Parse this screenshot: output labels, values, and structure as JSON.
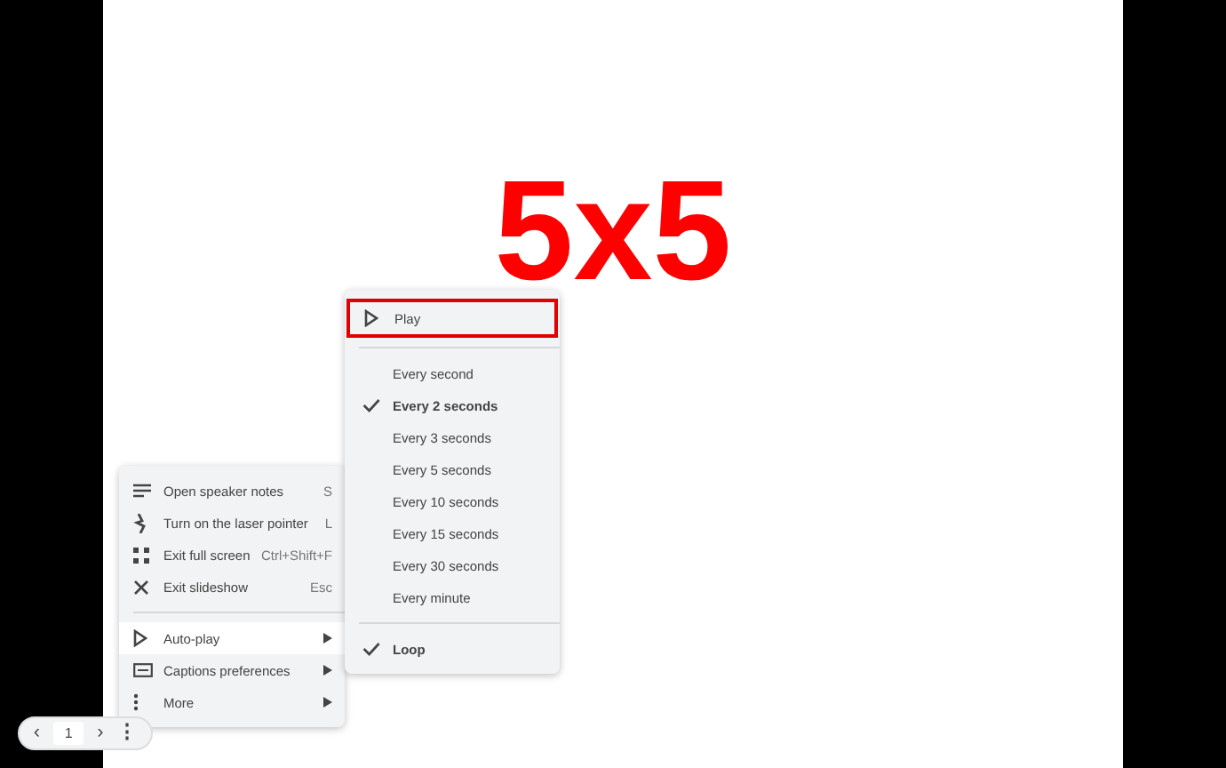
{
  "slide": {
    "title": "5x5"
  },
  "nav": {
    "prev": "‹",
    "page": "1",
    "next": "›",
    "more": "⋮"
  },
  "menu": {
    "items": [
      {
        "kind": "action",
        "label": "Open speaker notes",
        "shortcut": "S",
        "selected": false
      },
      {
        "kind": "action",
        "label": "Turn on the laser pointer",
        "shortcut": "L",
        "selected": false
      },
      {
        "kind": "action",
        "label": "Exit full screen",
        "shortcut": "Ctrl+Shift+F",
        "selected": false
      },
      {
        "kind": "action",
        "label": "Exit slideshow",
        "shortcut": "Esc",
        "selected": false
      },
      {
        "kind": "divider"
      },
      {
        "kind": "submenu",
        "label": "Auto-play",
        "selected": true
      },
      {
        "kind": "submenu",
        "label": "Captions preferences",
        "selected": false
      },
      {
        "kind": "submenu",
        "label": "More",
        "selected": false
      }
    ]
  },
  "autoplay_menu": {
    "items": [
      {
        "kind": "play",
        "label": "Play",
        "outlined": true
      },
      {
        "kind": "divider"
      },
      {
        "kind": "option",
        "label": "Every second",
        "checked": false
      },
      {
        "kind": "option",
        "label": "Every 2 seconds",
        "checked": true
      },
      {
        "kind": "option",
        "label": "Every 3 seconds",
        "checked": false
      },
      {
        "kind": "option",
        "label": "Every 5 seconds",
        "checked": false
      },
      {
        "kind": "option",
        "label": "Every 10 seconds",
        "checked": false
      },
      {
        "kind": "option",
        "label": "Every 15 seconds",
        "checked": false
      },
      {
        "kind": "option",
        "label": "Every 30 seconds",
        "checked": false
      },
      {
        "kind": "option",
        "label": "Every minute",
        "checked": false
      },
      {
        "kind": "divider"
      },
      {
        "kind": "option",
        "label": "Loop",
        "checked": true
      }
    ]
  }
}
